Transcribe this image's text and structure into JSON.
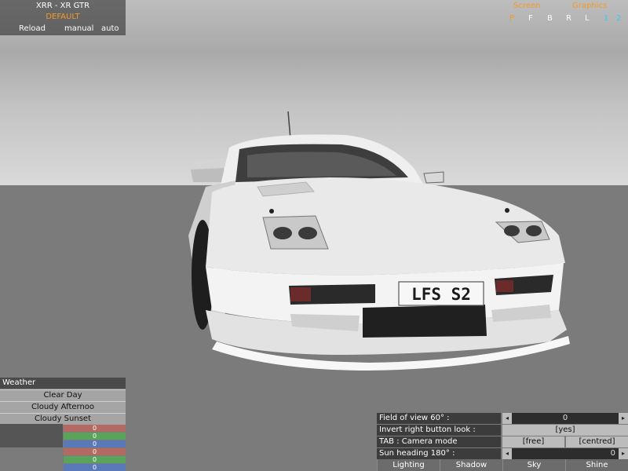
{
  "car_panel": {
    "car_name": "XRR - XR GTR",
    "skin_name": "DEFAULT",
    "reload_label": "Reload",
    "manual_label": "manual",
    "auto_label": "auto"
  },
  "view_panel": {
    "screen_label": "Screen",
    "graphics_label": "Graphics",
    "letters": [
      "P",
      "F",
      "B",
      "R",
      "L",
      "1",
      "2"
    ],
    "colors": {
      "inactive": "#ffffff",
      "selected": "#f29a29",
      "alt": "#33ccff"
    }
  },
  "scene": {
    "plate_text": "LFS S2",
    "car_color": "#e6e6e6"
  },
  "weather": {
    "title": "Weather",
    "items": [
      "Clear Day",
      "Cloudy Afternoo",
      "Cloudy Sunset"
    ],
    "color_bars": [
      {
        "value": "0",
        "color": "#b46a62"
      },
      {
        "value": "0",
        "color": "#59a35b"
      },
      {
        "value": "0",
        "color": "#5a79b8"
      },
      {
        "value": "0",
        "color": "#b46a62"
      },
      {
        "value": "0",
        "color": "#59a35b"
      },
      {
        "value": "0",
        "color": "#5a79b8"
      }
    ]
  },
  "settings": {
    "fov_label": "Field of view 60° :",
    "fov_value": "0",
    "invert_label": "Invert right button look :",
    "invert_value": "[yes]",
    "camera_label": "TAB : Camera mode",
    "camera_free": "[free]",
    "camera_centred": "[centred]",
    "sun_label": "Sun heading 180° :",
    "sun_value": "0",
    "left_arrow": "◂",
    "right_arrow": "▸"
  },
  "tabs": [
    "Lighting",
    "Shadow",
    "Sky",
    "Shine"
  ]
}
